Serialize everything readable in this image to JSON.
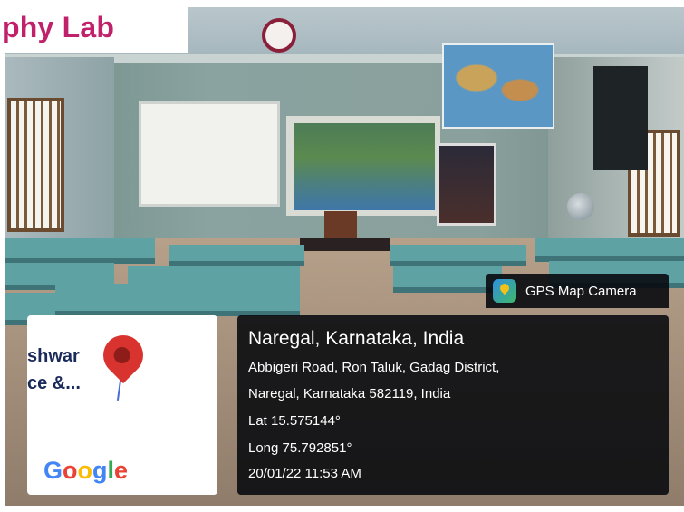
{
  "header": {
    "title": "phy Lab"
  },
  "gps": {
    "app_name": "GPS Map Camera",
    "place": "Naregal, Karnataka, India",
    "address_line1": "Abbigeri Road, Ron Taluk, Gadag District,",
    "address_line2": "Naregal, Karnataka 582119, India",
    "latitude": "Lat 15.575144°",
    "longitude": "Long 75.792851°",
    "datetime": "20/01/22 11:53 AM"
  },
  "map_thumb": {
    "line1": "shwar",
    "line2": "ce &...",
    "brand": [
      "G",
      "o",
      "o",
      "g",
      "l",
      "e"
    ]
  },
  "colors": {
    "title": "#c0216a",
    "overlay_bg": "#06080c",
    "pin": "#d8332f"
  },
  "icons": [
    "map-pin-icon",
    "gps-camera-app-icon",
    "wall-clock"
  ]
}
